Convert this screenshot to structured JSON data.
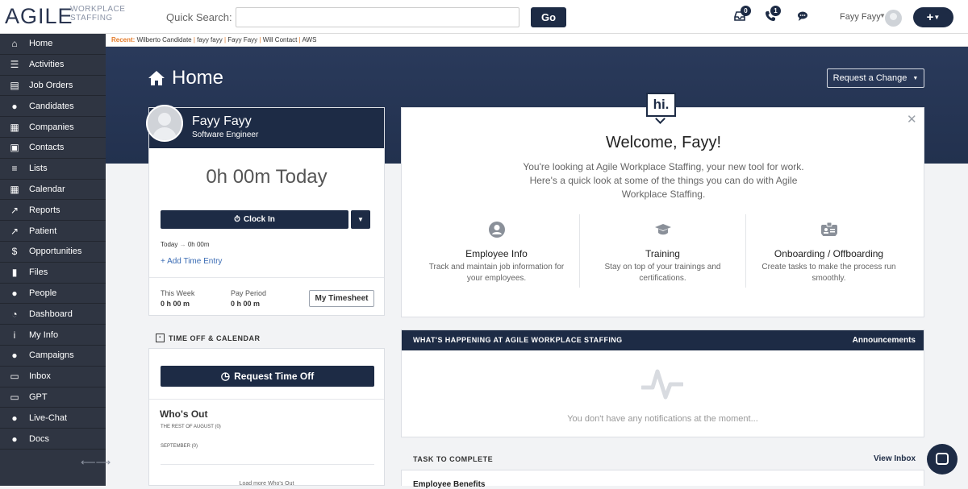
{
  "brand": {
    "name": "AGILE",
    "subtitle": "WORKPLACE STAFFING"
  },
  "search": {
    "label": "Quick Search:",
    "placeholder": "",
    "go_label": "Go"
  },
  "topbar": {
    "inbox_badge": "0",
    "phone_badge": "1",
    "user_name": "Fayy Fayy",
    "plus_label": "+"
  },
  "sidebar": {
    "items": [
      {
        "label": "Home",
        "icon": "home-icon"
      },
      {
        "label": "Activities",
        "icon": "activities-icon"
      },
      {
        "label": "Job Orders",
        "icon": "job-orders-icon"
      },
      {
        "label": "Candidates",
        "icon": "candidates-icon"
      },
      {
        "label": "Companies",
        "icon": "companies-icon"
      },
      {
        "label": "Contacts",
        "icon": "contacts-icon"
      },
      {
        "label": "Lists",
        "icon": "lists-icon"
      },
      {
        "label": "Calendar",
        "icon": "calendar-icon"
      },
      {
        "label": "Reports",
        "icon": "reports-icon"
      },
      {
        "label": "Patient",
        "icon": "patient-icon"
      },
      {
        "label": "Opportunities",
        "icon": "dollar-icon"
      },
      {
        "label": "Files",
        "icon": "files-icon"
      },
      {
        "label": "People",
        "icon": "people-icon"
      },
      {
        "label": "Dashboard",
        "icon": "dashboard-icon"
      },
      {
        "label": "My Info",
        "icon": "info-icon"
      },
      {
        "label": "Campaigns",
        "icon": "campaigns-icon"
      },
      {
        "label": "Inbox",
        "icon": "inbox-icon"
      },
      {
        "label": "GPT",
        "icon": "gpt-icon"
      },
      {
        "label": "Live-Chat",
        "icon": "chat-icon"
      },
      {
        "label": "Docs",
        "icon": "docs-icon"
      }
    ]
  },
  "recent": {
    "label": "Recent:",
    "items": [
      "Wilberto Candidate",
      "fayy fayy",
      "Fayy Fayy",
      "Will Contact",
      "AWS"
    ]
  },
  "page": {
    "title": "Home",
    "request_change_label": "Request a Change"
  },
  "profile": {
    "name": "Fayy Fayy",
    "role": "Software Engineer",
    "hours_today": "0h 00m Today",
    "clock_in_label": "Clock In",
    "today_label": "Today",
    "today_value": "0h 00m",
    "add_time_label": "+ Add Time Entry",
    "this_week_label": "This Week",
    "this_week_value": "0 h 00 m",
    "pay_period_label": "Pay Period",
    "pay_period_value": "0 h 00 m",
    "timesheet_label": "My Timesheet"
  },
  "time_off": {
    "title": "TIME OFF & CALENDAR",
    "request_label": "Request Time Off",
    "whos_out": "Who's Out",
    "rest_of_month": "THE REST OF AUGUST (0)",
    "next_month": "SEPTEMBER (0)",
    "load_more": "Load more Who's Out"
  },
  "welcome": {
    "hi": "hi.",
    "title": "Welcome, Fayy!",
    "description": "You're looking at Agile Workplace Staffing, your new tool for work. Here's a quick look at some of the things you can do with Agile Workplace Staffing.",
    "features": [
      {
        "title": "Employee Info",
        "desc": "Track and maintain job information for your employees.",
        "icon": "employee-icon"
      },
      {
        "title": "Training",
        "desc": "Stay on top of your trainings and certifications.",
        "icon": "graduation-cap-icon"
      },
      {
        "title": "Onboarding / Offboarding",
        "desc": "Create tasks to make the process run smoothly.",
        "icon": "id-card-icon"
      }
    ]
  },
  "happening": {
    "title": "WHAT'S HAPPENING AT AGILE WORKPLACE STAFFING",
    "announcements_label": "Announcements",
    "empty_text": "You don't have any notifications at the moment..."
  },
  "tasks": {
    "title": "TASK TO COMPLETE",
    "view_inbox_label": "View Inbox",
    "first_item_fragment": "Employee Benefits"
  },
  "colors": {
    "navy": "#1d2b45",
    "sidebar": "#2f3542",
    "recent_accent": "#e47c2b",
    "link": "#3b6cb4"
  }
}
